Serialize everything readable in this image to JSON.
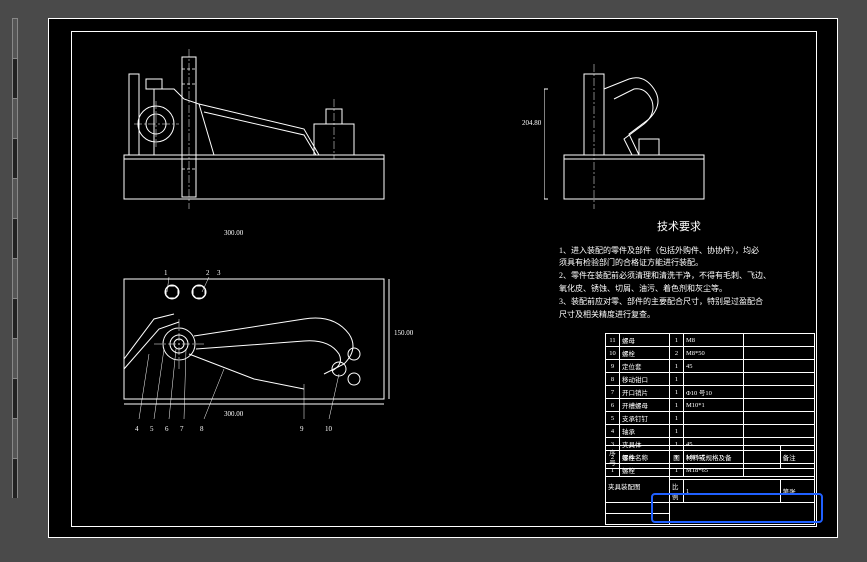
{
  "dims": {
    "front_width": "300.00",
    "side_height": "204.80",
    "plan_width": "300.00",
    "plan_height": "150.00"
  },
  "balloons": {
    "b1": "1",
    "b2": "2",
    "b5": "3",
    "b4": "4",
    "b3": "5",
    "b6": "6",
    "b7": "7",
    "b8": "8",
    "b9": "9",
    "b10": "10"
  },
  "tech_req": {
    "title": "技术要求",
    "line1": "1、进入装配的零件及部件（包括外购件、协协件），均必",
    "line2": "须具有检验部门的合格证方能进行装配。",
    "line3": "2、零件在装配前必须清理和清洗干净，不得有毛刺、飞边、",
    "line4": "氧化皮、锈蚀、切屑、油污、着色剂和灰尘等。",
    "line5": "3、装配前应对零、部件的主要配合尺寸，特别是过盈配合",
    "line6": "尺寸及相关精度进行复查。"
  },
  "parts": [
    {
      "num": "11",
      "name": "螺母",
      "qty": "1",
      "mat": "M8"
    },
    {
      "num": "10",
      "name": "螺栓",
      "qty": "2",
      "mat": "M8*50"
    },
    {
      "num": "9",
      "name": "定位套",
      "qty": "1",
      "mat": "45"
    },
    {
      "num": "8",
      "name": "移动钳口",
      "qty": "1",
      "mat": ""
    },
    {
      "num": "7",
      "name": "开口销片",
      "qty": "1",
      "mat": "Φ10 号10"
    },
    {
      "num": "6",
      "name": "开槽螺母",
      "qty": "1",
      "mat": "M10*1"
    },
    {
      "num": "5",
      "name": "支承钉钉",
      "qty": "1",
      "mat": ""
    },
    {
      "num": "4",
      "name": "轴承",
      "qty": "1",
      "mat": ""
    },
    {
      "num": "3",
      "name": "夹具体",
      "qty": "1",
      "mat": "45"
    },
    {
      "num": "2",
      "name": "螺栓",
      "qty": "1",
      "mat": "M8*65"
    },
    {
      "num": "1",
      "name": "螺栓",
      "qty": "1",
      "mat": "M18*65"
    }
  ],
  "title_block": {
    "hdr_num": "序号",
    "hdr_name": "零件名称",
    "hdr_icon": "图",
    "hdr_mat": "材料或规格及备",
    "hdr_note": "备注",
    "proj_name": "夹具装配图",
    "drawn": "比例",
    "scale": "1",
    "sheet": "第张"
  }
}
